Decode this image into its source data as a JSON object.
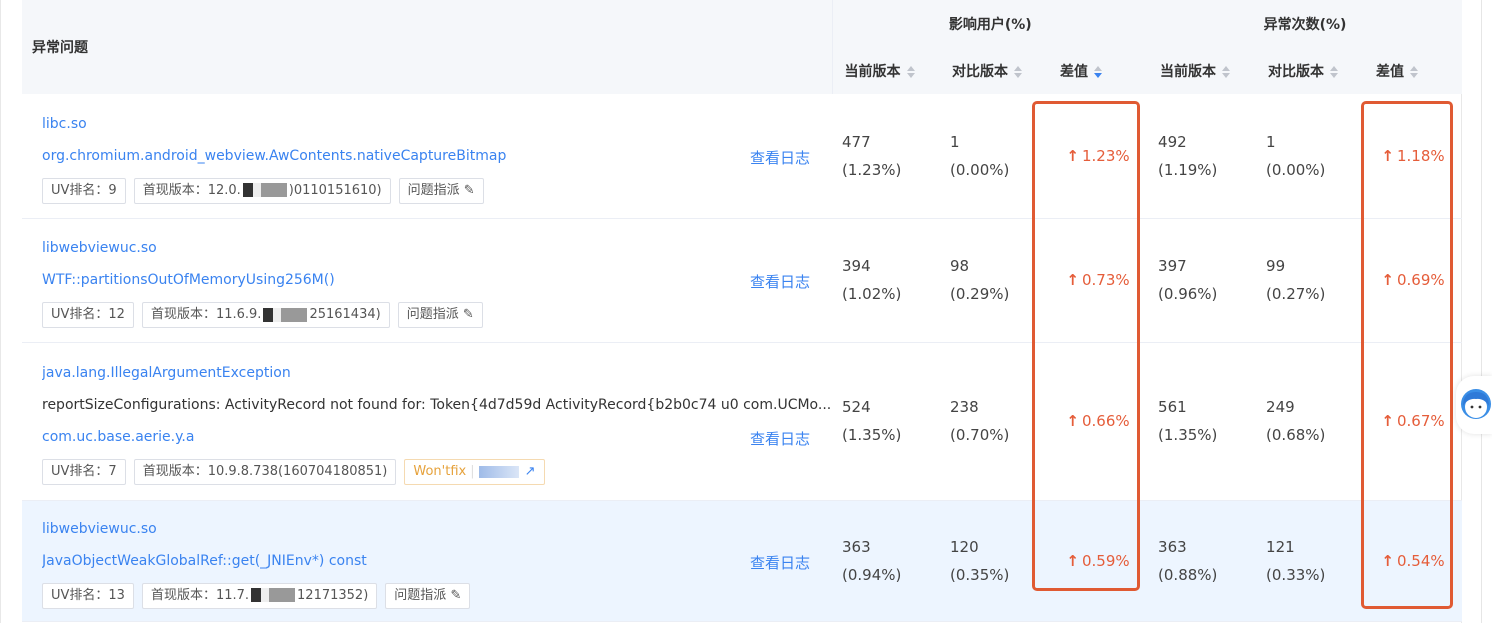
{
  "header": {
    "issue_col": "异常问题",
    "group_users": "影响用户(%)",
    "group_count": "异常次数(%)",
    "sub_current": "当前版本",
    "sub_compare": "对比版本",
    "sub_diff": "差值"
  },
  "rows": [
    {
      "lines": [
        "libc.so",
        "org.chromium.android_webview.AwContents.nativeCaptureBitmap"
      ],
      "line_types": [
        "link",
        "link"
      ],
      "log": "查看日志",
      "uv": "UV排名：9",
      "ver_prefix": "首现版本：12.0.",
      "ver_suffix": ")0110151610)",
      "assign": "问题指派",
      "users_cur": "477",
      "users_cur_pct": "(1.23%)",
      "users_cmp": "1",
      "users_cmp_pct": "(0.00%)",
      "users_diff": "1.23%",
      "count_cur": "492",
      "count_cur_pct": "(1.19%)",
      "count_cmp": "1",
      "count_cmp_pct": "(0.00%)",
      "count_diff": "1.18%"
    },
    {
      "lines": [
        "libwebviewuc.so",
        "WTF::partitionsOutOfMemoryUsing256M()"
      ],
      "line_types": [
        "link",
        "link"
      ],
      "log": "查看日志",
      "uv": "UV排名：12",
      "ver_prefix": "首现版本：11.6.9.",
      "ver_suffix": "25161434)",
      "assign": "问题指派",
      "users_cur": "394",
      "users_cur_pct": "(1.02%)",
      "users_cmp": "98",
      "users_cmp_pct": "(0.29%)",
      "users_diff": "0.73%",
      "count_cur": "397",
      "count_cur_pct": "(0.96%)",
      "count_cmp": "99",
      "count_cmp_pct": "(0.27%)",
      "count_diff": "0.69%"
    },
    {
      "lines": [
        "java.lang.IllegalArgumentException",
        "reportSizeConfigurations: ActivityRecord not found for: Token{4d7d59d ActivityRecord{b2b0c74 u0 com.UCMo...",
        "com.uc.base.aerie.y.a"
      ],
      "line_types": [
        "link",
        "plain",
        "link"
      ],
      "log": "查看日志",
      "uv": "UV排名：7",
      "ver_full": "首现版本：10.9.8.738(160704180851)",
      "status": "Won'tfix",
      "users_cur": "524",
      "users_cur_pct": "(1.35%)",
      "users_cmp": "238",
      "users_cmp_pct": "(0.70%)",
      "users_diff": "0.66%",
      "count_cur": "561",
      "count_cur_pct": "(1.35%)",
      "count_cmp": "249",
      "count_cmp_pct": "(0.68%)",
      "count_diff": "0.67%"
    },
    {
      "lines": [
        "libwebviewuc.so",
        "JavaObjectWeakGlobalRef::get(_JNIEnv*) const"
      ],
      "line_types": [
        "link",
        "link"
      ],
      "log": "查看日志",
      "uv": "UV排名：13",
      "ver_prefix": "首现版本：11.7.",
      "ver_suffix": "12171352)",
      "assign": "问题指派",
      "users_cur": "363",
      "users_cur_pct": "(0.94%)",
      "users_cmp": "120",
      "users_cmp_pct": "(0.35%)",
      "users_diff": "0.59%",
      "count_cur": "363",
      "count_cur_pct": "(0.88%)",
      "count_cmp": "121",
      "count_cmp_pct": "(0.33%)",
      "count_diff": "0.54%"
    }
  ],
  "colors": {
    "link": "#3a83f0",
    "diff": "#e55d3a",
    "highlight_box": "#e05a33",
    "row_highlight": "#edf5ff"
  },
  "icons": {
    "sort": "sort-caret-icon",
    "up_arrow": "arrow-up-icon",
    "edit": "pencil-icon",
    "external": "external-link-icon",
    "support": "support-avatar-icon"
  }
}
